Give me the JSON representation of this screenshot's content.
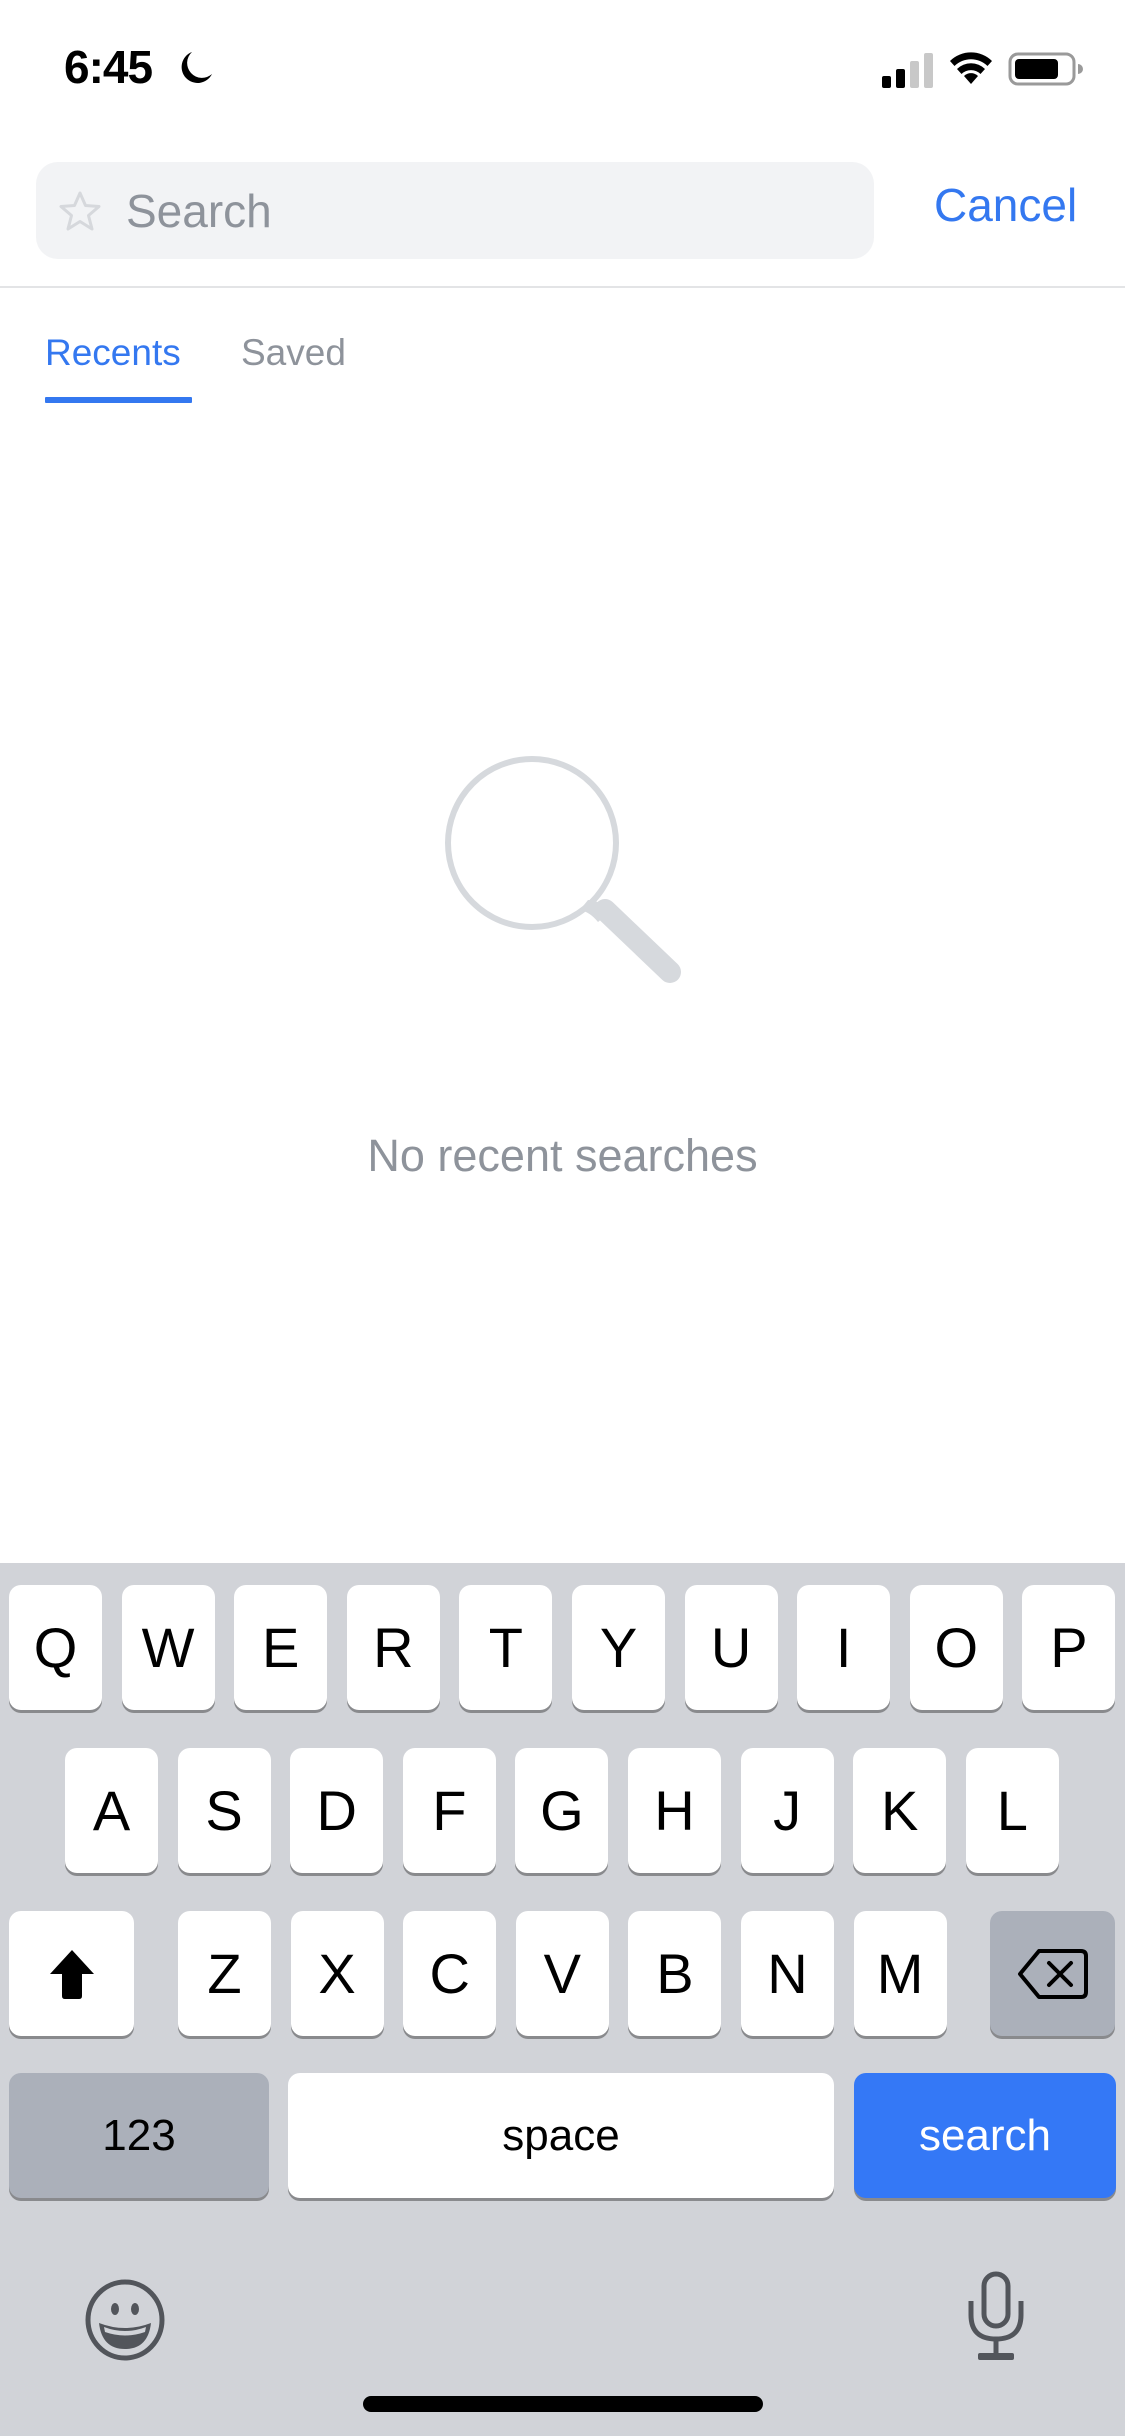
{
  "status_bar": {
    "time": "6:45",
    "focus_mode_icon": "moon-icon",
    "signal_bars_active": 2,
    "signal_bars_total": 4,
    "wifi_icon": "wifi-icon",
    "battery_level_percent": 80
  },
  "search": {
    "placeholder": "Search",
    "value": "",
    "leading_icon": "star-icon",
    "cancel_label": "Cancel"
  },
  "tabs": [
    {
      "label": "Recents",
      "active": true
    },
    {
      "label": "Saved",
      "active": false
    }
  ],
  "empty_state": {
    "icon": "magnifying-glass-icon",
    "message": "No recent searches"
  },
  "keyboard": {
    "row1": [
      "Q",
      "W",
      "E",
      "R",
      "T",
      "Y",
      "U",
      "I",
      "O",
      "P"
    ],
    "row2": [
      "A",
      "S",
      "D",
      "F",
      "G",
      "H",
      "J",
      "K",
      "L"
    ],
    "row3": [
      "Z",
      "X",
      "C",
      "V",
      "B",
      "N",
      "M"
    ],
    "shift_icon": "shift-arrow-icon",
    "delete_icon": "backspace-icon",
    "numbers_label": "123",
    "space_label": "space",
    "return_label": "search",
    "emoji_icon": "emoji-icon",
    "dictation_icon": "microphone-icon"
  },
  "colors": {
    "accent": "#3478f0",
    "secondary_text": "#8e939b",
    "search_field_bg": "#f2f3f5",
    "keyboard_bg": "#d1d3d8",
    "dark_key_bg": "#abb0ba",
    "return_key_bg": "#3478f6"
  }
}
